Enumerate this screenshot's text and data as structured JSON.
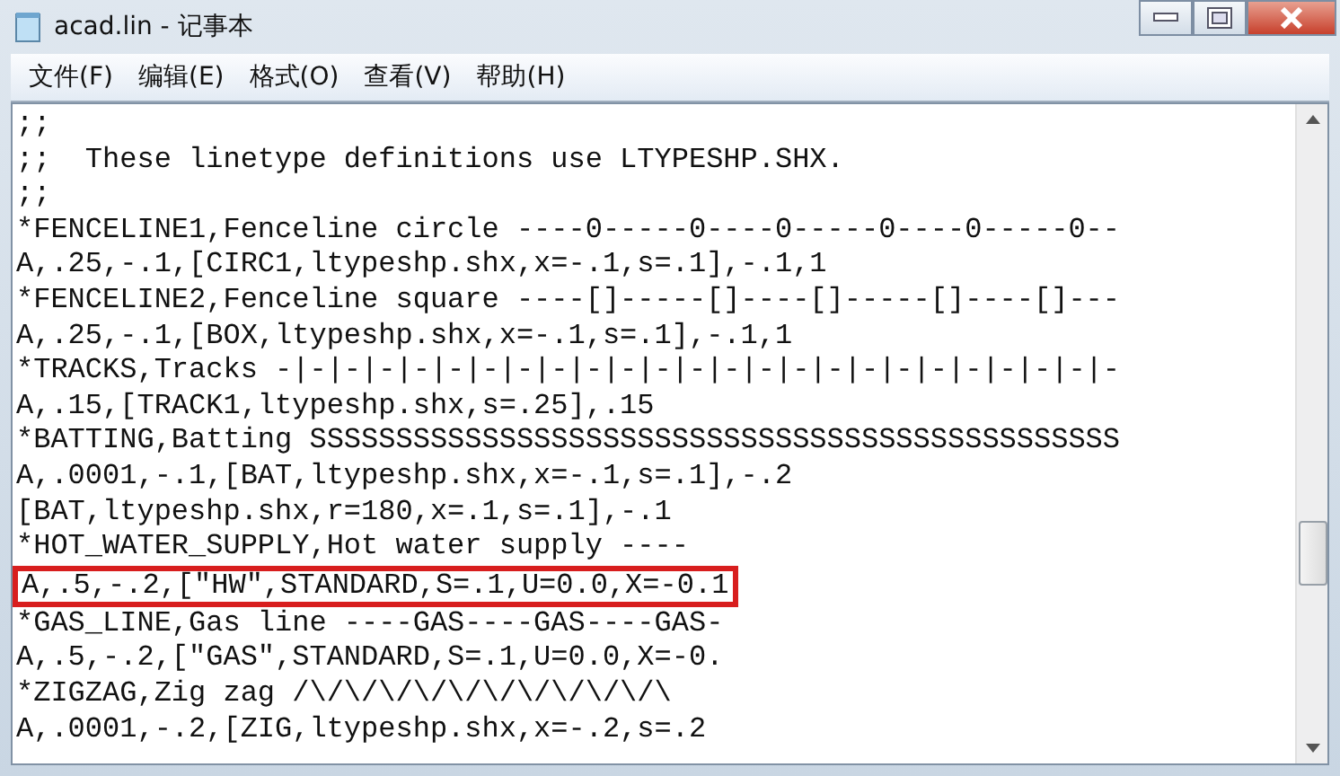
{
  "window": {
    "title": "acad.lin - 记事本"
  },
  "menu": [
    "文件(F)",
    "编辑(E)",
    "格式(O)",
    "查看(V)",
    "帮助(H)"
  ],
  "lines": [
    {
      "text": ";;",
      "highlighted": false
    },
    {
      "text": ";;  These linetype definitions use LTYPESHP.SHX.",
      "highlighted": false
    },
    {
      "text": ";;",
      "highlighted": false
    },
    {
      "text": "*FENCELINE1,Fenceline circle ----0-----0----0-----0----0-----0--",
      "highlighted": false
    },
    {
      "text": "A,.25,-.1,[CIRC1,ltypeshp.shx,x=-.1,s=.1],-.1,1",
      "highlighted": false
    },
    {
      "text": "*FENCELINE2,Fenceline square ----[]-----[]----[]-----[]----[]---",
      "highlighted": false
    },
    {
      "text": "A,.25,-.1,[BOX,ltypeshp.shx,x=-.1,s=.1],-.1,1",
      "highlighted": false
    },
    {
      "text": "*TRACKS,Tracks -|-|-|-|-|-|-|-|-|-|-|-|-|-|-|-|-|-|-|-|-|-|-|-|-",
      "highlighted": false
    },
    {
      "text": "A,.15,[TRACK1,ltypeshp.shx,s=.25],.15",
      "highlighted": false
    },
    {
      "text": "*BATTING,Batting SSSSSSSSSSSSSSSSSSSSSSSSSSSSSSSSSSSSSSSSSSSSSSS",
      "highlighted": false
    },
    {
      "text": "A,.0001,-.1,[BAT,ltypeshp.shx,x=-.1,s=.1],-.2",
      "highlighted": false
    },
    {
      "text": "[BAT,ltypeshp.shx,r=180,x=.1,s=.1],-.1",
      "highlighted": false
    },
    {
      "text": "*HOT_WATER_SUPPLY,Hot water supply ----",
      "highlighted": false
    },
    {
      "text": "A,.5,-.2,[\"HW\",STANDARD,S=.1,U=0.0,X=-0.1",
      "highlighted": true
    },
    {
      "text": "*GAS_LINE,Gas line ----GAS----GAS----GAS-",
      "highlighted": false
    },
    {
      "text": "A,.5,-.2,[\"GAS\",STANDARD,S=.1,U=0.0,X=-0.",
      "highlighted": false
    },
    {
      "text": "*ZIGZAG,Zig zag /\\/\\/\\/\\/\\/\\/\\/\\/\\/\\/\\",
      "highlighted": false
    },
    {
      "text": "A,.0001,-.2,[ZIG,ltypeshp.shx,x=-.2,s=.2",
      "highlighted": false
    }
  ]
}
